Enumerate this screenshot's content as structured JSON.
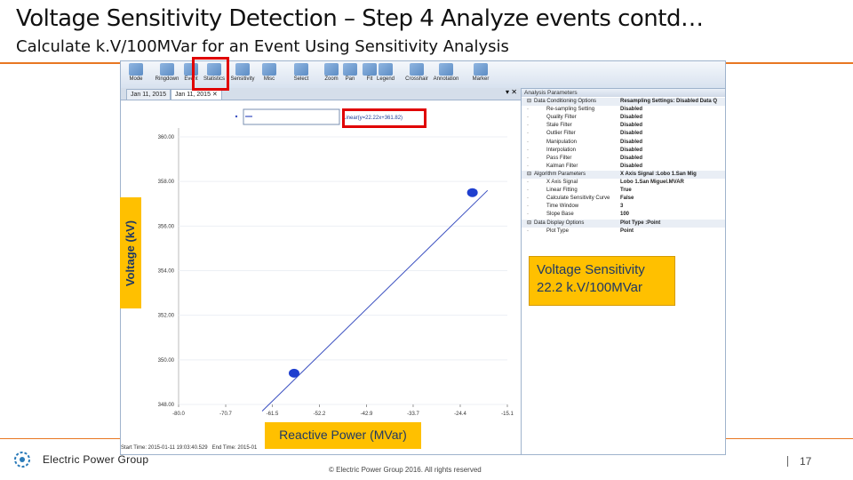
{
  "slide": {
    "title": "Voltage Sensitivity Detection – Step 4 Analyze events contd…",
    "subtitle": "Calculate k.V/100MVar for an Event Using Sensitivity Analysis",
    "page_number": "17",
    "copyright": "© Electric Power Group 2016. All rights reserved",
    "logo_text": "Electric Power Group",
    "accent_color": "#e87722",
    "callout_color": "#ffc000",
    "highlight_color": "#e00000"
  },
  "ribbon": {
    "buttons": [
      {
        "label": "Mode",
        "icon": "mode-icon"
      },
      {
        "label": "Ringdown",
        "icon": "ringdown-icon"
      },
      {
        "label": "Event",
        "icon": "event-icon"
      },
      {
        "label": "Statistics",
        "icon": "statistics-icon"
      },
      {
        "label": "Sensitivity",
        "icon": "sensitivity-icon"
      },
      {
        "label": "Misc",
        "icon": "misc-icon"
      },
      {
        "label": "Select",
        "icon": "select-icon"
      },
      {
        "label": "Zoom",
        "icon": "zoom-icon"
      },
      {
        "label": "Pan",
        "icon": "pan-icon"
      },
      {
        "label": "Fit",
        "icon": "fit-icon"
      },
      {
        "label": "Legend",
        "icon": "legend-icon"
      },
      {
        "label": "Crosshair",
        "icon": "crosshair-icon"
      },
      {
        "label": "Annotation",
        "icon": "annotation-icon"
      },
      {
        "label": "Marker",
        "icon": "marker-icon"
      }
    ]
  },
  "tabs": [
    {
      "label": "Jan 11, 2015"
    },
    {
      "label": "Jan 11, 2015"
    }
  ],
  "legend_text": "Linear(y=22.22x+361.82)",
  "callout": {
    "line1": "Voltage Sensitivity",
    "line2": "22.2 k.V/100MVar"
  },
  "axis": {
    "ylabel": "Voltage (kV)",
    "xlabel": "Reactive Power (MVar)"
  },
  "chart_data": {
    "type": "scatter",
    "y_ticks": [
      "360.00",
      "358.00",
      "356.00",
      "354.00",
      "352.00",
      "350.00",
      "348.00"
    ],
    "x_ticks": [
      "-80.0",
      "-70.7",
      "-61.5",
      "-52.2",
      "-42.9",
      "-33.7",
      "-24.4",
      "-15.1"
    ],
    "xlim": [
      -80.0,
      -15.1
    ],
    "ylim": [
      348.0,
      360.0
    ],
    "fit": {
      "slope": 0.2222,
      "intercept": 361.82
    },
    "fit_line": [
      [
        -63.5,
        347.7
      ],
      [
        -19.0,
        357.6
      ]
    ],
    "clusters": [
      {
        "x": -57.2,
        "y": 349.4
      },
      {
        "x": -22.0,
        "y": 357.5
      }
    ],
    "legend": "top-left"
  },
  "params": {
    "title": "Analysis Parameters",
    "rows": [
      {
        "k": "Data Conditioning Options",
        "v": "Resampling Settings: Disabled Data Q",
        "cat": true
      },
      {
        "k": "Re-sampling Setting",
        "v": "Disabled"
      },
      {
        "k": "Quality Filter",
        "v": "Disabled"
      },
      {
        "k": "Stale Filter",
        "v": "Disabled"
      },
      {
        "k": "Outlier Filter",
        "v": "Disabled"
      },
      {
        "k": "Manipulation",
        "v": "Disabled"
      },
      {
        "k": "Interpolation",
        "v": "Disabled"
      },
      {
        "k": "Pass Filter",
        "v": "Disabled"
      },
      {
        "k": "Kalman Filter",
        "v": "Disabled"
      },
      {
        "k": "Algorithm Parameters",
        "v": "X Axis Signal   :Lobo 1.San Mig",
        "cat": true
      },
      {
        "k": "X Axis Signal",
        "v": "Lobo 1.San Miguel.MVAR"
      },
      {
        "k": "Linear Fitting",
        "v": "True"
      },
      {
        "k": "Calculate Sensitivity Curve",
        "v": "False"
      },
      {
        "k": "Time Window",
        "v": "3"
      },
      {
        "k": "Slope Base",
        "v": "100"
      },
      {
        "k": "Data Display Options",
        "v": "Plot Type        :Point",
        "cat": true
      },
      {
        "k": "Plot Type",
        "v": "Point"
      }
    ]
  },
  "status": {
    "start": "Start Time: 2015-01-11 19:03:40.529",
    "end": "End Time: 2015-01"
  }
}
